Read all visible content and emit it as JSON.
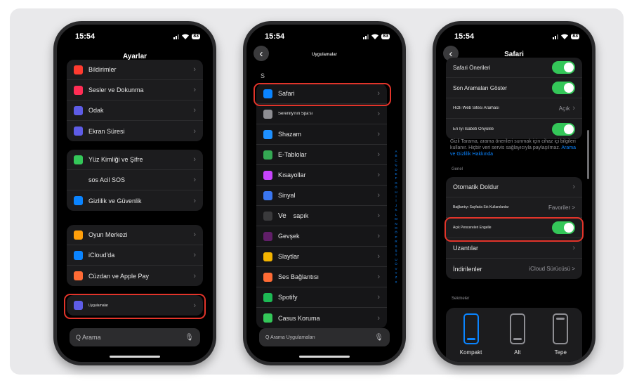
{
  "phone1": {
    "time": "15:54",
    "battery": "83",
    "title": "Ayarlar",
    "group1": [
      {
        "label": "Bildirimler",
        "icon": "bell-icon",
        "color": "#ff3b30"
      },
      {
        "label": "Sesler ve Dokunma",
        "icon": "speaker-icon",
        "color": "#ff2d55"
      },
      {
        "label": "Odak",
        "icon": "moon-icon",
        "color": "#5e5ce6"
      },
      {
        "label": "Ekran Süresi",
        "icon": "hourglass-icon",
        "color": "#5e5ce6"
      }
    ],
    "group2": [
      {
        "label": "Yüz Kimliği ve Şifre",
        "icon": "faceid-icon",
        "color": "#34c759"
      },
      {
        "label": "sos Acil SOS",
        "icon": "sos-icon",
        "color": "#1c1c1e"
      },
      {
        "label": "Gizlilik ve Güvenlik",
        "icon": "hand-icon",
        "color": "#0a84ff"
      }
    ],
    "group3": [
      {
        "label": "Oyun Merkezi",
        "icon": "gamecenter-icon",
        "color": "#ff9f0a"
      },
      {
        "label": "iCloud'da",
        "icon": "cloud-icon",
        "color": "#0a84ff"
      },
      {
        "label": "Cüzdan ve Apple Pay",
        "icon": "wallet-icon",
        "color": "#ff6b35"
      }
    ],
    "group4": [
      {
        "label": "Uygulamalar",
        "icon": "apps-grid-icon",
        "color": "#5e5ce6"
      }
    ],
    "search": "Q Arama"
  },
  "phone2": {
    "time": "15:54",
    "battery": "83",
    "title": "Uygulamalar",
    "section": "S",
    "apps": [
      {
        "label": "Safari",
        "icon": "safari-icon",
        "color": "#0a84ff"
      },
      {
        "label": "Serenity'nin Spa'sı",
        "icon": "spa-icon",
        "color": "#8e8e93"
      },
      {
        "label": "Shazam",
        "icon": "shazam-icon",
        "color": "#1e90ff"
      },
      {
        "label": "E-Tablolar",
        "icon": "sheets-icon",
        "color": "#34a853"
      },
      {
        "label": "Kısayollar",
        "icon": "shortcuts-icon",
        "color": "#c644fc"
      },
      {
        "label": "Sinyal",
        "icon": "signal-icon",
        "color": "#3a76f0"
      },
      {
        "label": "sapık",
        "icon": "ve-icon",
        "color": "#3a3a3c",
        "prefix": "Ve"
      },
      {
        "label": "Gevşek",
        "icon": "slack-icon",
        "color": "#611f69"
      },
      {
        "label": "Slaytlar",
        "icon": "slides-icon",
        "color": "#f4b400"
      },
      {
        "label": "Ses Bağlantısı",
        "icon": "soundlink-icon",
        "color": "#ff6b35"
      },
      {
        "label": "Spotify",
        "icon": "spotify-icon",
        "color": "#1db954"
      },
      {
        "label": "Casus Koruma",
        "icon": "spy-icon",
        "color": "#34c759"
      }
    ],
    "index": [
      "A",
      "B",
      "C",
      "Ç",
      "D",
      "E",
      "F",
      "G",
      "Ğ",
      "H",
      "I",
      "İ",
      "J",
      "K",
      "L",
      "M",
      "N",
      "O",
      "Ö",
      "P",
      "R",
      "S",
      "Ş",
      "T",
      "U",
      "Ü",
      "V",
      "Y",
      "Z",
      "#"
    ],
    "search": "Q Arama Uygulamaları"
  },
  "phone3": {
    "time": "15:54",
    "battery": "83",
    "title": "Safari",
    "rows1": [
      {
        "label": "Safari Önerileri",
        "kind": "toggle"
      },
      {
        "label": "Son Aramaları Göster",
        "kind": "toggle"
      },
      {
        "label": "Hızlı Web Sitesi Araması",
        "kind": "value",
        "value": "Açık"
      },
      {
        "label": "En İyi İsabeti Önyükle",
        "kind": "toggle"
      }
    ],
    "note": "Gizli Tarama, arama önerileri sunmak için cihaz içi bilgileri kullanır. Hiçbir veri servis sağlayıcıyla paylaşılmaz.",
    "note_link": "Arama ve Gizlilik Hakkında",
    "section1": "Genel",
    "rows2": [
      {
        "label": "Otomatik Doldur",
        "kind": "chevron"
      },
      {
        "label": "Bağlantıyı Sayfada Sık Kullanılanlar",
        "kind": "value",
        "value": "Favoriler >"
      },
      {
        "label": "Açık Pencereleri Engelle",
        "kind": "toggle"
      },
      {
        "label": "Uzantılar",
        "kind": "chevron"
      },
      {
        "label": "İndirilenler",
        "kind": "value",
        "value": "iCloud Sürücüsü >"
      }
    ],
    "section2": "Sekmeler",
    "tabs": [
      {
        "label": "Kompakt",
        "selected": true
      },
      {
        "label": "Alt",
        "selected": false
      },
      {
        "label": "Tepe",
        "selected": false
      }
    ]
  }
}
